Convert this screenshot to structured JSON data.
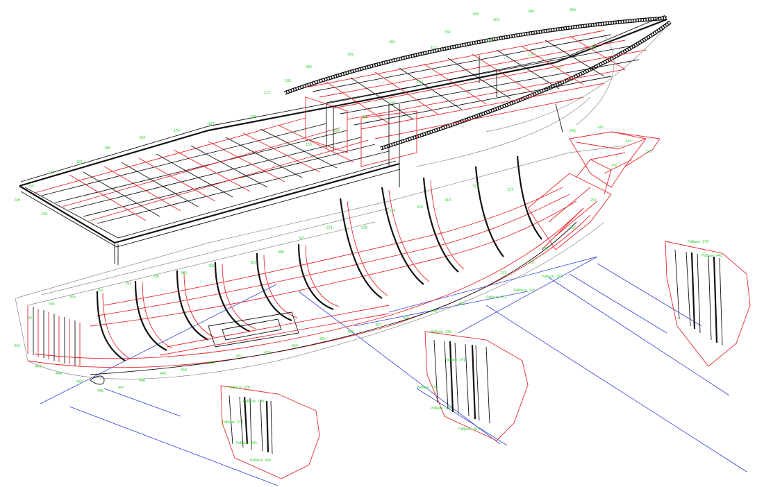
{
  "drawing": {
    "colors": {
      "structure_black": "#111111",
      "structure_red": "#e8262a",
      "hull_outline": "#8a8a8a",
      "baseline_blue": "#2f3fd6",
      "label_green": "#2fd12f",
      "background": "#ffffff"
    },
    "labels": [
      "198",
      "303",
      "300",
      "304",
      "302",
      "301",
      "199",
      "305",
      "103",
      "111",
      "112",
      "113",
      "114",
      "147",
      "141",
      "140",
      "130",
      "153",
      "154",
      "155",
      "156",
      "157",
      "179",
      "184",
      "180",
      "181",
      "182",
      "239",
      "240",
      "241",
      "242",
      "243",
      "244",
      "245",
      "250",
      "251",
      "252",
      "305",
      "310",
      "311",
      "312",
      "317",
      "318",
      "319",
      "320",
      "370",
      "371",
      "375",
      "380",
      "381",
      "382",
      "383",
      "390",
      "391",
      "392",
      "393",
      "395",
      "441",
      "442",
      "443",
      "444",
      "445",
      "446",
      "447",
      "448",
      "449",
      "450",
      "451",
      "452",
      "453",
      "454",
      "455",
      "456",
      "457",
      "458",
      "459",
      "460",
      "PaBaue 311",
      "PaBaue 324",
      "PaBaue 318",
      "PaBaue 370",
      "PaBaue 198",
      "PaBaue 371",
      "PaBaue 181",
      "PaBaue 443",
      "PaBaue 258",
      "PaBaue 141",
      "PaBaue 130",
      "PaBaue 210",
      "PaBaue 303",
      "PaBaue 179",
      "PaBaue 445"
    ]
  }
}
